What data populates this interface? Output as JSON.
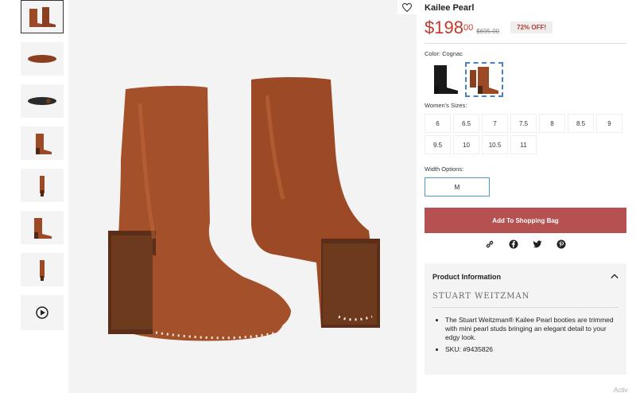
{
  "product": {
    "title": "Kailee Pearl",
    "price_main": "$198",
    "price_cents": "00",
    "old_price": "$695.00",
    "discount_badge": "72% OFF!",
    "color_label": "Color: Cognac",
    "sizes_label": "Women's Sizes:",
    "sizes": [
      "6",
      "6.5",
      "7",
      "7.5",
      "8",
      "8.5",
      "9",
      "9.5",
      "10",
      "10.5",
      "11"
    ],
    "width_label": "Width Options:",
    "width_option": "M",
    "cart_button": "Add To Shopping Bag"
  },
  "info": {
    "heading": "Product Information",
    "brand": "STUART WEITZMAN",
    "bullets": [
      "The Stuart Weitzman® Kailee Pearl booties are trimmed with mini pearl studs bringing an elegant detail to your edgy look.",
      "SKU: #9435826"
    ]
  },
  "icons": [
    "heart-icon",
    "link-icon",
    "facebook-icon",
    "twitter-icon",
    "pinterest-icon",
    "chevron-up-icon",
    "play-icon"
  ],
  "colors": {
    "accent": "#b65151",
    "price": "#c0392b",
    "boot": "#9c4a25"
  },
  "watermark": "Activ"
}
